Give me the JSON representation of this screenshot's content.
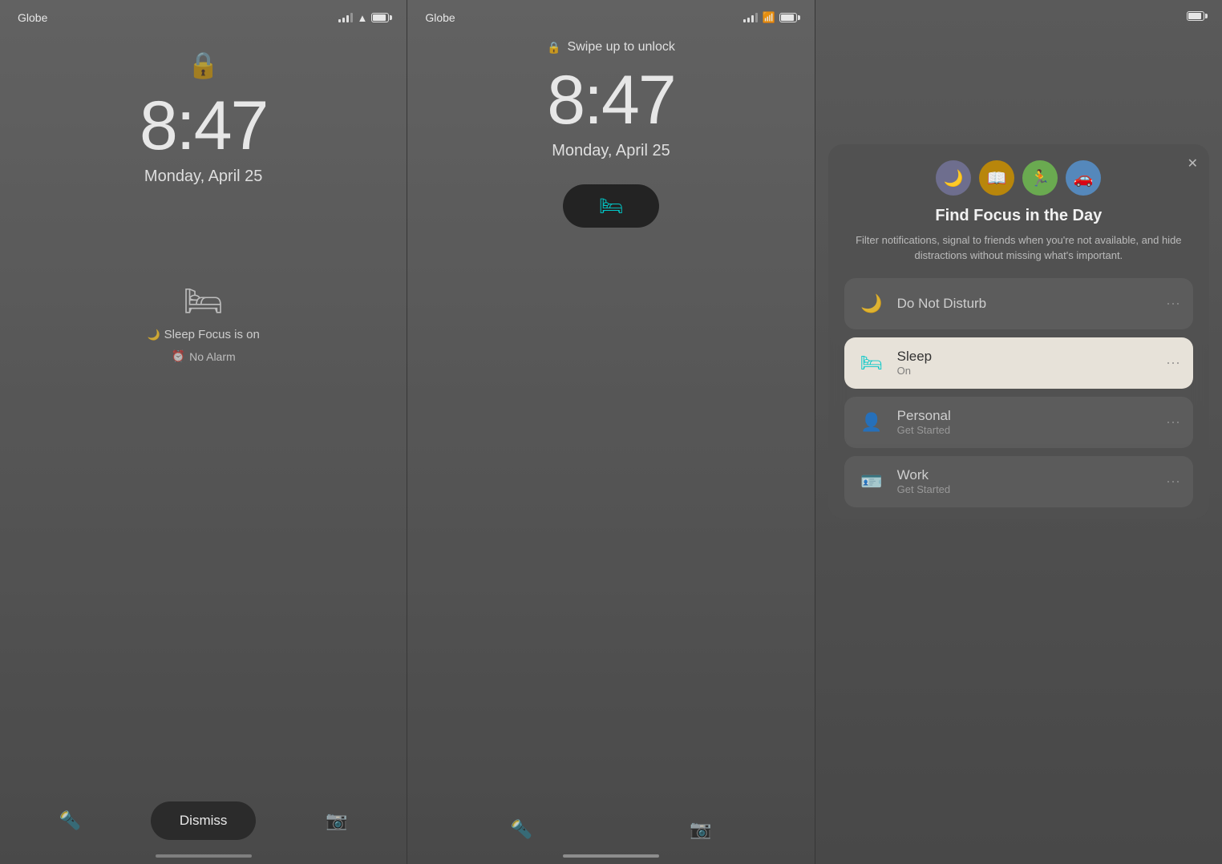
{
  "panel1": {
    "carrier": "Globe",
    "time": "8:47",
    "date": "Monday, April 25",
    "sleep_focus_label": "Sleep Focus is on",
    "alarm_label": "No Alarm",
    "dismiss_label": "Dismiss"
  },
  "panel2": {
    "carrier": "Globe",
    "swipe_label": "Swipe up to unlock",
    "time": "8:47",
    "date": "Monday, April 25"
  },
  "panel3": {
    "focus_title": "Find Focus in the Day",
    "focus_desc": "Filter notifications, signal to friends when you're not available, and hide distractions without missing what's important.",
    "items": [
      {
        "id": "do-not-disturb",
        "name": "Do Not Disturb",
        "sub": "",
        "active": false,
        "icon": "🌙"
      },
      {
        "id": "sleep",
        "name": "Sleep",
        "sub": "On",
        "active": true,
        "icon": "🛏"
      },
      {
        "id": "personal",
        "name": "Personal",
        "sub": "Get Started",
        "active": false,
        "icon": "👤"
      },
      {
        "id": "work",
        "name": "Work",
        "sub": "Get Started",
        "active": false,
        "icon": "🪪"
      }
    ]
  }
}
